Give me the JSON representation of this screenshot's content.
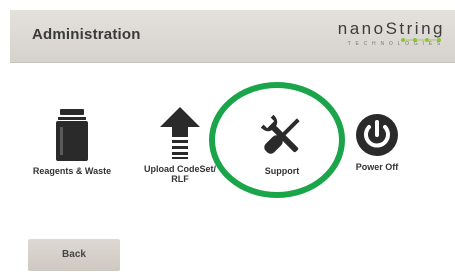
{
  "header": {
    "title": "Administration",
    "logo_text": "nanoString",
    "logo_subtext": "TECHNOLOGIES"
  },
  "tiles": [
    {
      "label": "Reagents & Waste",
      "icon": "reagent-bottle-icon"
    },
    {
      "label": "Upload CodeSet/ RLF",
      "icon": "upload-arrow-icon"
    },
    {
      "label": "Support",
      "icon": "wrench-screwdriver-icon"
    },
    {
      "label": "Power Off",
      "icon": "power-icon"
    }
  ],
  "footer": {
    "back_label": "Back"
  },
  "annotation": {
    "highlight_color": "#1aa54a"
  },
  "colors": {
    "header_bg": "#dcd8d3",
    "icon": "#2a2a2a"
  }
}
